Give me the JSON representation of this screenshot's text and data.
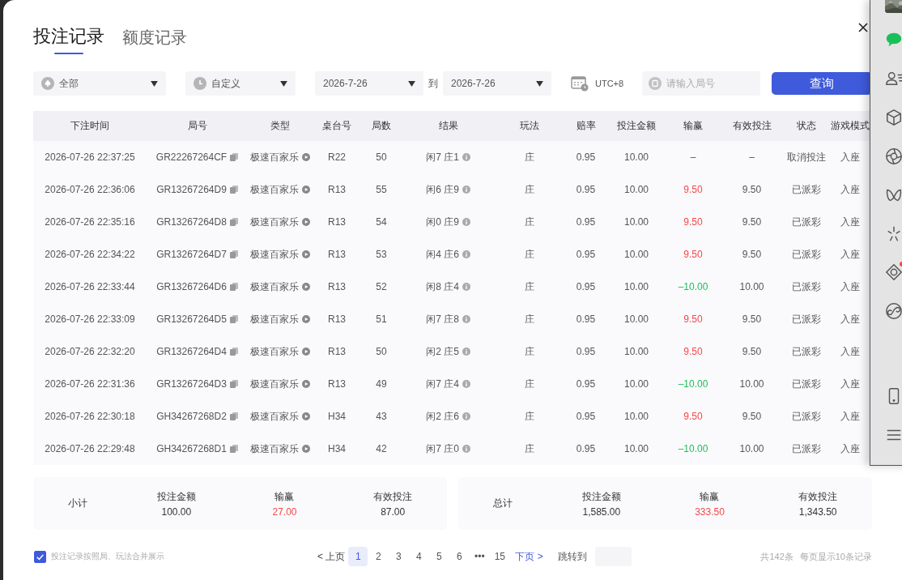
{
  "tabs": [
    {
      "label": "投注记录",
      "selected": true
    },
    {
      "label": "额度记录",
      "selected": false
    }
  ],
  "filters": {
    "game": "全部",
    "period": "自定义",
    "date_from": "2026-7-26",
    "to_label": "到",
    "date_to": "2026-7-26",
    "timezone": "UTC+8",
    "round_placeholder": "请输入局号",
    "query_button": "查询"
  },
  "table": {
    "columns": [
      "下注时间",
      "局号",
      "类型",
      "桌台号",
      "局数",
      "结果",
      "玩法",
      "赔率",
      "投注金额",
      "输赢",
      "有效投注",
      "状态",
      "游戏模式"
    ],
    "rows": [
      {
        "time": "2026-07-26 22:37:25",
        "round": "GR22267264CF",
        "type": "极速百家乐",
        "table": "R22",
        "count": "50",
        "result": "闲7 庄1",
        "bet_type": "庄",
        "odds": "0.95",
        "amount": "10.00",
        "win_loss": {
          "text": "–"
        },
        "valid": "–",
        "status": "取消投注",
        "mode": "入座"
      },
      {
        "time": "2026-07-26 22:36:06",
        "round": "GR13267264D9",
        "type": "极速百家乐",
        "table": "R13",
        "count": "55",
        "result": "闲6 庄9",
        "bet_type": "庄",
        "odds": "0.95",
        "amount": "10.00",
        "win_loss": {
          "text": "9.50",
          "color": "#f5484a"
        },
        "valid": "9.50",
        "status": "已派彩",
        "mode": "入座"
      },
      {
        "time": "2026-07-26 22:35:16",
        "round": "GR13267264D8",
        "type": "极速百家乐",
        "table": "R13",
        "count": "54",
        "result": "闲0 庄9",
        "bet_type": "庄",
        "odds": "0.95",
        "amount": "10.00",
        "win_loss": {
          "text": "9.50",
          "color": "#f5484a"
        },
        "valid": "9.50",
        "status": "已派彩",
        "mode": "入座"
      },
      {
        "time": "2026-07-26 22:34:22",
        "round": "GR13267264D7",
        "type": "极速百家乐",
        "table": "R13",
        "count": "53",
        "result": "闲4 庄6",
        "bet_type": "庄",
        "odds": "0.95",
        "amount": "10.00",
        "win_loss": {
          "text": "9.50",
          "color": "#f5484a"
        },
        "valid": "9.50",
        "status": "已派彩",
        "mode": "入座"
      },
      {
        "time": "2026-07-26 22:33:44",
        "round": "GR13267264D6",
        "type": "极速百家乐",
        "table": "R13",
        "count": "52",
        "result": "闲8 庄4",
        "bet_type": "庄",
        "odds": "0.95",
        "amount": "10.00",
        "win_loss": {
          "text": "–10.00",
          "color": "#1bbf5a"
        },
        "valid": "10.00",
        "status": "已派彩",
        "mode": "入座"
      },
      {
        "time": "2026-07-26 22:33:09",
        "round": "GR13267264D5",
        "type": "极速百家乐",
        "table": "R13",
        "count": "51",
        "result": "闲7 庄8",
        "bet_type": "庄",
        "odds": "0.95",
        "amount": "10.00",
        "win_loss": {
          "text": "9.50",
          "color": "#f5484a"
        },
        "valid": "9.50",
        "status": "已派彩",
        "mode": "入座"
      },
      {
        "time": "2026-07-26 22:32:20",
        "round": "GR13267264D4",
        "type": "极速百家乐",
        "table": "R13",
        "count": "50",
        "result": "闲2 庄5",
        "bet_type": "庄",
        "odds": "0.95",
        "amount": "10.00",
        "win_loss": {
          "text": "9.50",
          "color": "#f5484a"
        },
        "valid": "9.50",
        "status": "已派彩",
        "mode": "入座"
      },
      {
        "time": "2026-07-26 22:31:36",
        "round": "GR13267264D3",
        "type": "极速百家乐",
        "table": "R13",
        "count": "49",
        "result": "闲7 庄4",
        "bet_type": "庄",
        "odds": "0.95",
        "amount": "10.00",
        "win_loss": {
          "text": "–10.00",
          "color": "#1bbf5a"
        },
        "valid": "10.00",
        "status": "已派彩",
        "mode": "入座"
      },
      {
        "time": "2026-07-26 22:30:18",
        "round": "GH34267268D2",
        "type": "极速百家乐",
        "table": "H34",
        "count": "43",
        "result": "闲2 庄6",
        "bet_type": "庄",
        "odds": "0.95",
        "amount": "10.00",
        "win_loss": {
          "text": "9.50",
          "color": "#f5484a"
        },
        "valid": "9.50",
        "status": "已派彩",
        "mode": "入座"
      },
      {
        "time": "2026-07-26 22:29:48",
        "round": "GH34267268D1",
        "type": "极速百家乐",
        "table": "H34",
        "count": "42",
        "result": "闲7 庄0",
        "bet_type": "庄",
        "odds": "0.95",
        "amount": "10.00",
        "win_loss": {
          "text": "–10.00",
          "color": "#1bbf5a"
        },
        "valid": "10.00",
        "status": "已派彩",
        "mode": "入座"
      }
    ]
  },
  "summaries": [
    {
      "title": "小计",
      "fields": [
        {
          "label": "投注金额",
          "value": "100.00",
          "color": "#333333"
        },
        {
          "label": "输赢",
          "value": "27.00",
          "color": "#f5484a"
        },
        {
          "label": "有效投注",
          "value": "87.00",
          "color": "#333333"
        }
      ]
    },
    {
      "title": "总计",
      "fields": [
        {
          "label": "投注金额",
          "value": "1,585.00",
          "color": "#333333"
        },
        {
          "label": "输赢",
          "value": "333.50",
          "color": "#f5484a"
        },
        {
          "label": "有效投注",
          "value": "1,343.50",
          "color": "#333333"
        }
      ]
    }
  ],
  "merge_option": {
    "label": "投注记录按照局、玩法合并展示",
    "checked": true
  },
  "pagination": {
    "prev": "< 上页",
    "pages": [
      {
        "label": "1",
        "selected": true
      },
      {
        "label": "2",
        "selected": false
      },
      {
        "label": "3",
        "selected": false
      },
      {
        "label": "4",
        "selected": false
      },
      {
        "label": "5",
        "selected": false
      },
      {
        "label": "6",
        "selected": false
      },
      {
        "label": "•••",
        "selected": false
      },
      {
        "label": "15",
        "selected": false
      }
    ],
    "next": "下页 >",
    "jump_label": "跳转到",
    "total": "共142条",
    "per_page": "每页显示10条记录"
  },
  "sidebar": {
    "items": [
      {
        "notification": false
      },
      {
        "notification": false
      },
      {
        "notification": false
      },
      {
        "notification": false
      },
      {
        "notification": false
      },
      {
        "notification": false
      },
      {
        "notification": true
      },
      {
        "notification": false
      },
      {
        "notification": false
      },
      {
        "notification": false
      }
    ]
  }
}
